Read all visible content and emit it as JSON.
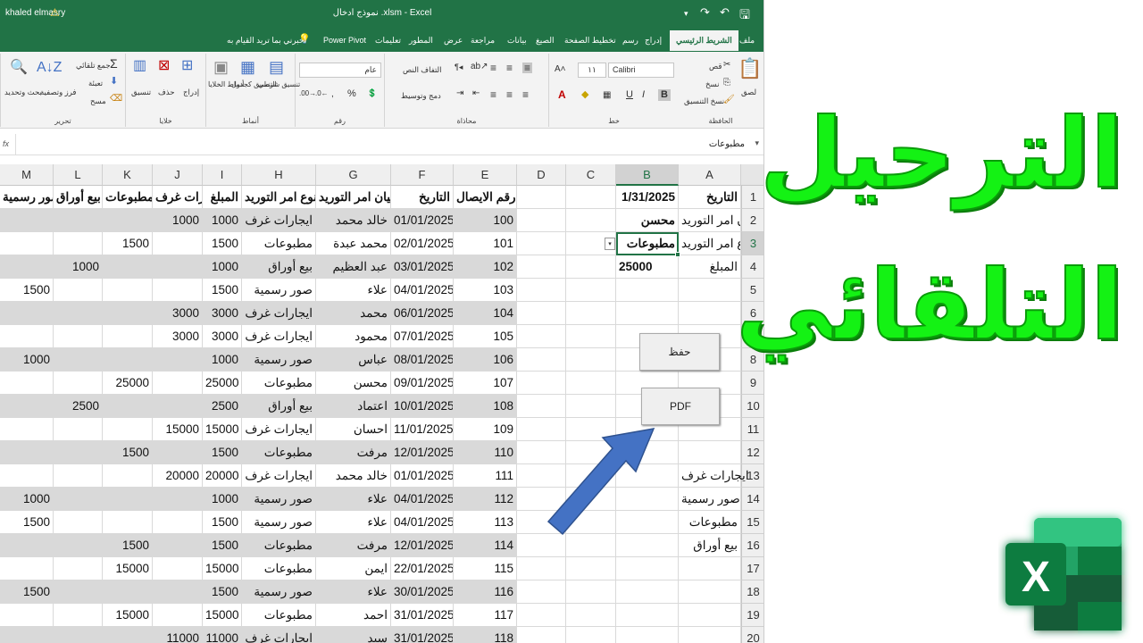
{
  "titlebar": {
    "user": "khaled elmasry",
    "title": "نموذج ادخال .xlsm - Excel"
  },
  "ribbon_tabs": [
    "ملف",
    "الشريط الرئيسي",
    "إدراج",
    "رسم",
    "تخطيط الصفحة",
    "الصيغ",
    "بيانات",
    "مراجعة",
    "عرض",
    "المطور",
    "تعليمات",
    "Power Pivot",
    "أخبرني بما تريد القيام به"
  ],
  "ribbon": {
    "clipboard": {
      "paste": "لصق",
      "cut": "قص",
      "copy": "نسخ",
      "format_painter": "نسخ التنسيق",
      "group": "الحافظة"
    },
    "font": {
      "name": "Calibri",
      "size": "١١",
      "group": "خط",
      "bold": "B",
      "italic": "I",
      "underline": "U"
    },
    "alignment": {
      "wrap": "التفاف النص",
      "merge": "دمج وتوسيط",
      "group": "محاذاة"
    },
    "number": {
      "format": "عام",
      "group": "رقم"
    },
    "styles": {
      "conditional": "تنسيق شرطي",
      "as_table": "التنسيق كجدول",
      "cell_styles": "أنماط الخلايا",
      "group": "أنماط"
    },
    "cells": {
      "insert": "إدراج",
      "delete": "حذف",
      "format": "تنسيق",
      "group": "خلايا"
    },
    "editing": {
      "autosum": "جمع تلقائي",
      "fill": "تعبئة",
      "clear": "مسح",
      "sort": "فرز وتصفية",
      "find": "بحث وتحديد",
      "group": "تحرير"
    }
  },
  "formula_bar": {
    "fx": "fx",
    "value": "مطبوعات"
  },
  "columns": [
    "A",
    "B",
    "C",
    "D",
    "E",
    "F",
    "G",
    "H",
    "I",
    "J",
    "K",
    "L",
    "M"
  ],
  "rows": [
    "1",
    "2",
    "3",
    "4",
    "5",
    "6",
    "7",
    "8",
    "9",
    "10",
    "11",
    "12",
    "13",
    "14",
    "15",
    "16",
    "17",
    "18",
    "19",
    "20"
  ],
  "form": {
    "labels": [
      "التاريخ",
      "بيان امر التوريد",
      "نوع امر التوريد",
      "المبلغ"
    ],
    "values": [
      "1/31/2025",
      "محسن",
      "مطبوعات",
      "25000"
    ],
    "categories": [
      "ايجارات غرف",
      "صور رسمية",
      "مطبوعات",
      "بيع أوراق"
    ]
  },
  "buttons": {
    "save": "حفظ",
    "pdf": "PDF"
  },
  "table": {
    "headers": [
      "رقم الايصال",
      "التاريخ",
      "بيان امر التوريد",
      "نوع امر التوريد",
      "المبلغ",
      "ايجارات غرف",
      "مطبوعات",
      "بيع أوراق",
      "صور رسمية"
    ],
    "rows": [
      [
        "100",
        "01/01/2025",
        "خالد محمد",
        "ايجارات غرف",
        "1000",
        "1000",
        "",
        "",
        ""
      ],
      [
        "101",
        "02/01/2025",
        "محمد عبدة",
        "مطبوعات",
        "1500",
        "",
        "1500",
        "",
        ""
      ],
      [
        "102",
        "03/01/2025",
        "عبد العظيم",
        "بيع أوراق",
        "1000",
        "",
        "",
        "1000",
        ""
      ],
      [
        "103",
        "04/01/2025",
        "علاء",
        "صور رسمية",
        "1500",
        "",
        "",
        "",
        "1500"
      ],
      [
        "104",
        "06/01/2025",
        "محمد",
        "ايجارات غرف",
        "3000",
        "3000",
        "",
        "",
        ""
      ],
      [
        "105",
        "07/01/2025",
        "محمود",
        "ايجارات غرف",
        "3000",
        "3000",
        "",
        "",
        ""
      ],
      [
        "106",
        "08/01/2025",
        "عباس",
        "صور رسمية",
        "1000",
        "",
        "",
        "",
        "1000"
      ],
      [
        "107",
        "09/01/2025",
        "محسن",
        "مطبوعات",
        "25000",
        "",
        "25000",
        "",
        ""
      ],
      [
        "108",
        "10/01/2025",
        "اعتماد",
        "بيع أوراق",
        "2500",
        "",
        "",
        "2500",
        ""
      ],
      [
        "109",
        "11/01/2025",
        "احسان",
        "ايجارات غرف",
        "15000",
        "15000",
        "",
        "",
        ""
      ],
      [
        "110",
        "12/01/2025",
        "مرفت",
        "مطبوعات",
        "1500",
        "",
        "1500",
        "",
        ""
      ],
      [
        "111",
        "01/01/2025",
        "خالد محمد",
        "ايجارات غرف",
        "20000",
        "20000",
        "",
        "",
        ""
      ],
      [
        "112",
        "04/01/2025",
        "علاء",
        "صور رسمية",
        "1000",
        "",
        "",
        "",
        "1000"
      ],
      [
        "113",
        "04/01/2025",
        "علاء",
        "صور رسمية",
        "1500",
        "",
        "",
        "",
        "1500"
      ],
      [
        "114",
        "12/01/2025",
        "مرفت",
        "مطبوعات",
        "1500",
        "",
        "1500",
        "",
        ""
      ],
      [
        "115",
        "22/01/2025",
        "ايمن",
        "مطبوعات",
        "15000",
        "",
        "15000",
        "",
        ""
      ],
      [
        "116",
        "30/01/2025",
        "علاء",
        "صور رسمية",
        "1500",
        "",
        "",
        "",
        "1500"
      ],
      [
        "117",
        "31/01/2025",
        "احمد",
        "مطبوعات",
        "15000",
        "",
        "15000",
        "",
        ""
      ],
      [
        "118",
        "31/01/2025",
        "سيد",
        "ايجارات غرف",
        "11000",
        "11000",
        "",
        "",
        ""
      ]
    ]
  },
  "overlay": {
    "line1": "الترحيل",
    "line2": "التلقائي",
    "logo": "X"
  },
  "colors": {
    "excel_green": "#217346",
    "title_green": "#14f214",
    "arrow_blue": "#4472c4"
  }
}
